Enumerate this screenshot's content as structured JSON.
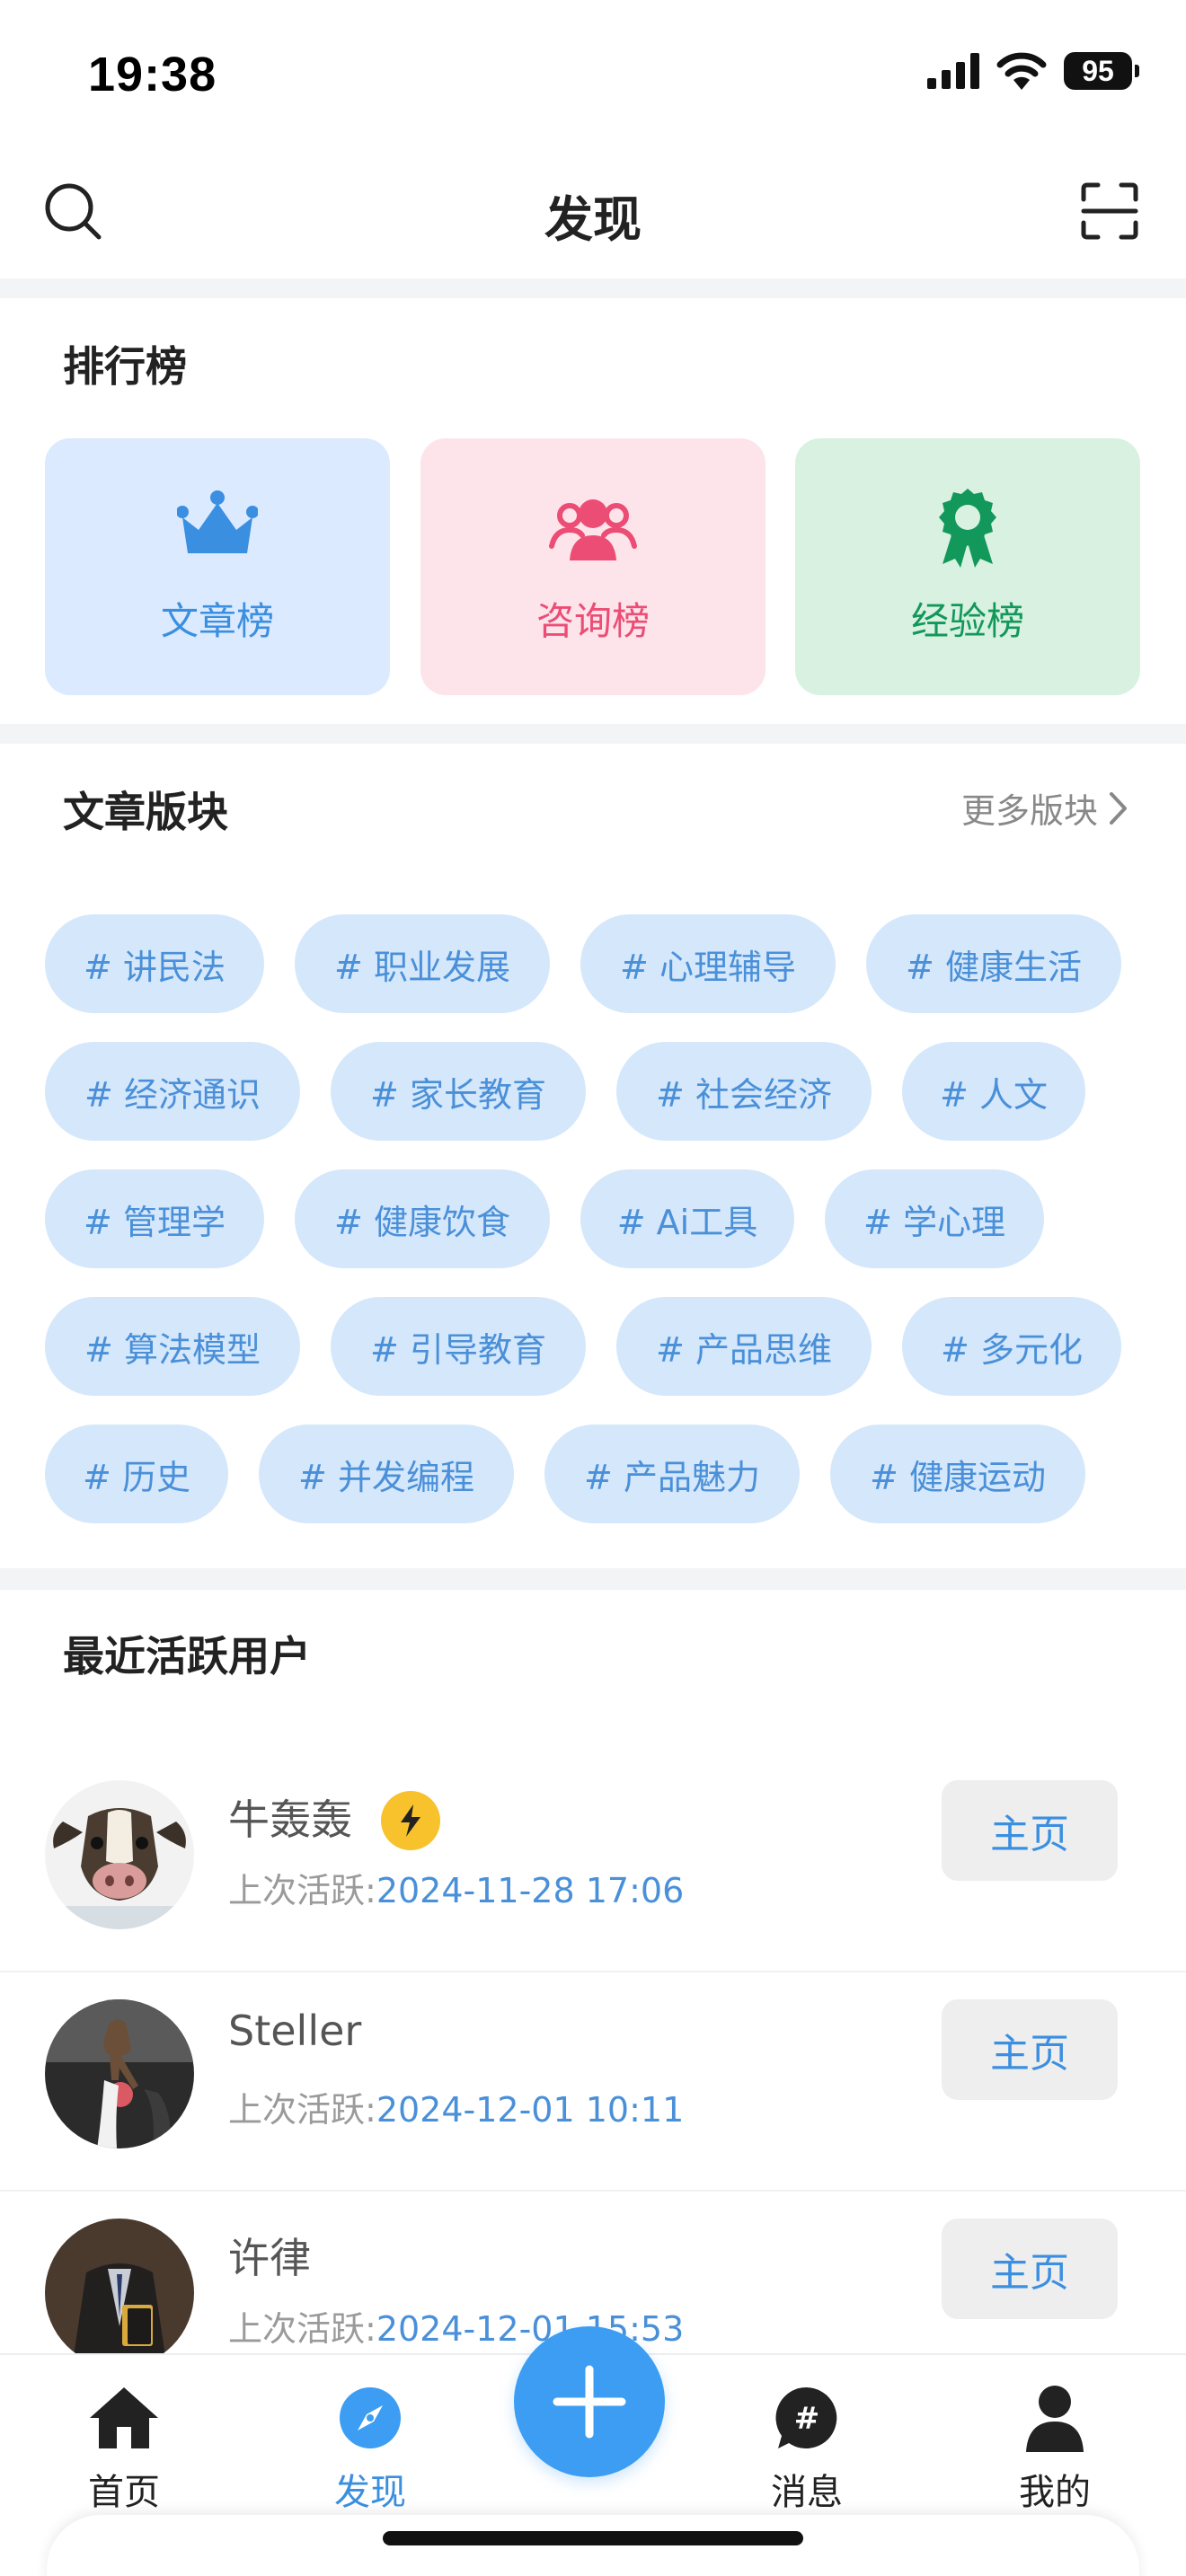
{
  "status_bar": {
    "time": "19:38",
    "battery": "95"
  },
  "header": {
    "title": "发现"
  },
  "leaderboards": {
    "title": "排行榜",
    "cards": [
      {
        "label": "文章榜",
        "icon": "crown-icon",
        "color": "#3b8fe0"
      },
      {
        "label": "咨询榜",
        "icon": "people-group-icon",
        "color": "#ec4d75"
      },
      {
        "label": "经验榜",
        "icon": "award-medal-icon",
        "color": "#12985a"
      }
    ]
  },
  "topics": {
    "title": "文章版块",
    "more_label": "更多版块",
    "tags": [
      "# 讲民法",
      "# 职业发展",
      "# 心理辅导",
      "# 健康生活",
      "# 经济通识",
      "# 家长教育",
      "# 社会经济",
      "# 人文",
      "# 管理学",
      "# 健康饮食",
      "# Ai工具",
      "# 学心理",
      "# 算法模型",
      "# 引导教育",
      "# 产品思维",
      "# 多元化",
      "# 历史",
      "# 并发编程",
      "# 产品魅力",
      "# 健康运动"
    ]
  },
  "active_users": {
    "title": "最近活跃用户",
    "last_active_label": "上次活跃:",
    "home_label": "主页",
    "users": [
      {
        "name": "牛轰轰",
        "last_active": "2024-11-28 17:06",
        "badge": "lightning-icon"
      },
      {
        "name": "Steller",
        "last_active": "2024-12-01 10:11"
      },
      {
        "name": "许律",
        "last_active": "2024-12-01 15:53"
      }
    ]
  },
  "tab_bar": {
    "tabs": [
      {
        "label": "首页",
        "icon": "home-icon"
      },
      {
        "label": "发现",
        "icon": "compass-icon",
        "active": true
      },
      {
        "label": "消息",
        "icon": "hashtag-chat-icon"
      },
      {
        "label": "我的",
        "icon": "person-icon"
      }
    ],
    "fab_icon": "plus-icon"
  },
  "colors": {
    "accent": "#3d9df2",
    "tag_bg": "#d5e7fb",
    "tag_text": "#4a90d9"
  }
}
